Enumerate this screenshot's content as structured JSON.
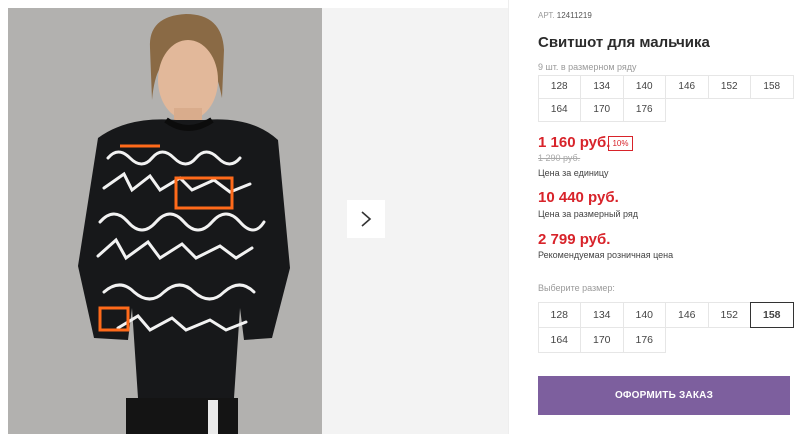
{
  "product": {
    "article_label": "АРТ.",
    "article_number": "12411219",
    "title": "Свитшот для мальчика"
  },
  "pack": {
    "label": "9 шт. в размерном ряду",
    "sizes": [
      "128",
      "134",
      "140",
      "146",
      "152",
      "158",
      "164",
      "170",
      "176"
    ]
  },
  "pricing": {
    "unit_price": "1 160 руб.",
    "discount_badge": "10%",
    "old_price": "1 290 руб.",
    "unit_note": "Цена за единицу",
    "pack_price": "10 440 руб.",
    "pack_note": "Цена за размерный ряд",
    "retail_price": "2 799 руб.",
    "retail_note": "Рекомендуемая розничная цена"
  },
  "size_selector": {
    "label": "Выберите размер:",
    "sizes": [
      "128",
      "134",
      "140",
      "146",
      "152",
      "158",
      "164",
      "170",
      "176"
    ],
    "selected": "158"
  },
  "actions": {
    "order_label": "ОФОРМИТЬ ЗАКАЗ"
  },
  "colors": {
    "price_red": "#d8232a",
    "order_button": "#7d5f9e"
  },
  "icons": {
    "next_arrow": "chevron-right-icon"
  }
}
